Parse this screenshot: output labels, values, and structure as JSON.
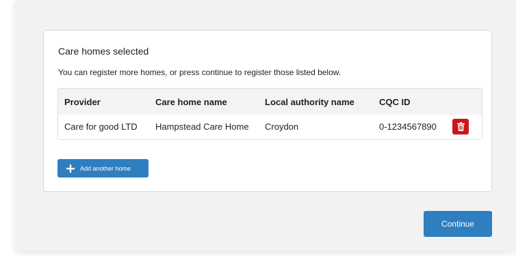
{
  "card": {
    "title": "Care homes selected",
    "subtitle": "You can register more homes, or press continue to register those listed below."
  },
  "table": {
    "headers": [
      "Provider",
      "Care home name",
      "Local authority name",
      "CQC ID"
    ],
    "rows": [
      [
        "Care for good LTD",
        "Hampstead Care Home",
        "Croydon",
        "0-1234567890"
      ]
    ]
  },
  "actions": {
    "delete_icon": "trash-icon",
    "add_label": "Add another home",
    "add_icon": "plus-icon",
    "continue_label": "Continue"
  },
  "colors": {
    "primary": "#2f7ebf",
    "danger": "#d0141b",
    "background": "#f2f2f2",
    "header_bg": "#f3f3f3"
  }
}
